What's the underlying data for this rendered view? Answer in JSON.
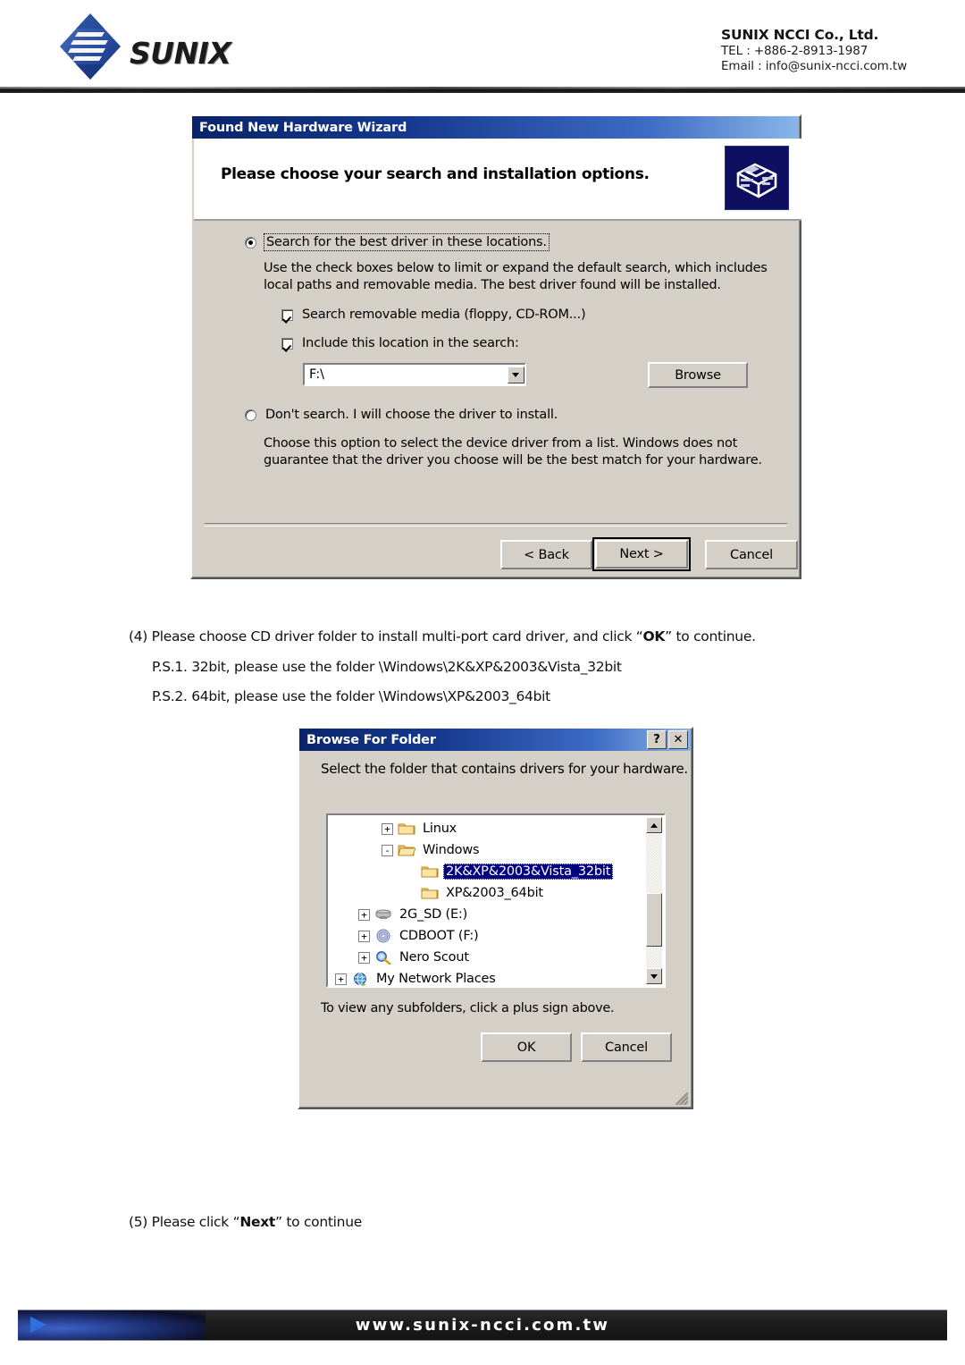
{
  "header": {
    "logo_word": "SUNIX",
    "company_name": "SUNIX NCCI Co., Ltd.",
    "tel": "TEL : +886-2-8913-1987",
    "email": "Email : info@sunix-ncci.com.tw"
  },
  "wizard": {
    "title": "Found New Hardware Wizard",
    "heading": "Please choose your search and installation options.",
    "option_search_label": "Search for the best driver in these locations.",
    "option_search_selected": true,
    "search_description": "Use the check boxes below to limit or expand the default search, which includes local paths and removable media. The best driver found will be installed.",
    "checkbox_removable_label": "Search removable media (floppy, CD-ROM...)",
    "checkbox_removable_checked": true,
    "checkbox_location_label": "Include this location in the search:",
    "checkbox_location_checked": true,
    "location_value": "F:\\",
    "browse_label": "Browse",
    "option_dontsearch_label": "Don't search. I will choose the driver to install.",
    "option_dontsearch_selected": false,
    "dontsearch_description": "Choose this option to select the device driver from a list.  Windows does not guarantee that the driver you choose will be the best match for your hardware.",
    "back_label": "< Back",
    "next_label": "Next >",
    "cancel_label": "Cancel"
  },
  "instructions": {
    "step4_prefix": "(4) Please choose CD driver folder to install multi-port card driver, and click “",
    "step4_bold": "OK",
    "step4_suffix": "” to continue.",
    "ps1": "P.S.1. 32bit, please use the folder \\Windows\\2K&XP&2003&Vista_32bit",
    "ps2": "P.S.2. 64bit, please use the folder \\Windows\\XP&2003_64bit",
    "step5_prefix": "(5) Please click “",
    "step5_bold": "Next",
    "step5_suffix": "” to continue"
  },
  "browse_dialog": {
    "title": "Browse For Folder",
    "help_button": "?",
    "close_button": "✕",
    "prompt": "Select the folder that contains drivers for your hardware.",
    "hint": "To view any subfolders, click a plus sign above.",
    "ok_label": "OK",
    "cancel_label": "Cancel",
    "tree": [
      {
        "label": "Linux",
        "indent": 2,
        "expander": "+",
        "icon": "folder-icon",
        "selected": false
      },
      {
        "label": "Windows",
        "indent": 2,
        "expander": "-",
        "icon": "folder-open-icon",
        "selected": false
      },
      {
        "label": "2K&XP&2003&Vista_32bit",
        "indent": 3,
        "expander": "",
        "icon": "folder-icon",
        "selected": true
      },
      {
        "label": "XP&2003_64bit",
        "indent": 3,
        "expander": "",
        "icon": "folder-icon",
        "selected": false
      },
      {
        "label": "2G_SD (E:)",
        "indent": 1,
        "expander": "+",
        "icon": "removable-disk-icon",
        "selected": false
      },
      {
        "label": "CDBOOT (F:)",
        "indent": 1,
        "expander": "+",
        "icon": "cd-drive-icon",
        "selected": false
      },
      {
        "label": "Nero Scout",
        "indent": 1,
        "expander": "+",
        "icon": "nero-scout-icon",
        "selected": false
      },
      {
        "label": "My Network Places",
        "indent": 0,
        "expander": "+",
        "icon": "network-icon",
        "selected": false
      }
    ]
  },
  "footer": {
    "url": "www.sunix-ncci.com.tw"
  },
  "colors": {
    "title_blue": "#0a246a",
    "dialog_face": "#d4d0c8",
    "selection_blue": "#000080",
    "brand_blue": "#2a4fa0"
  }
}
